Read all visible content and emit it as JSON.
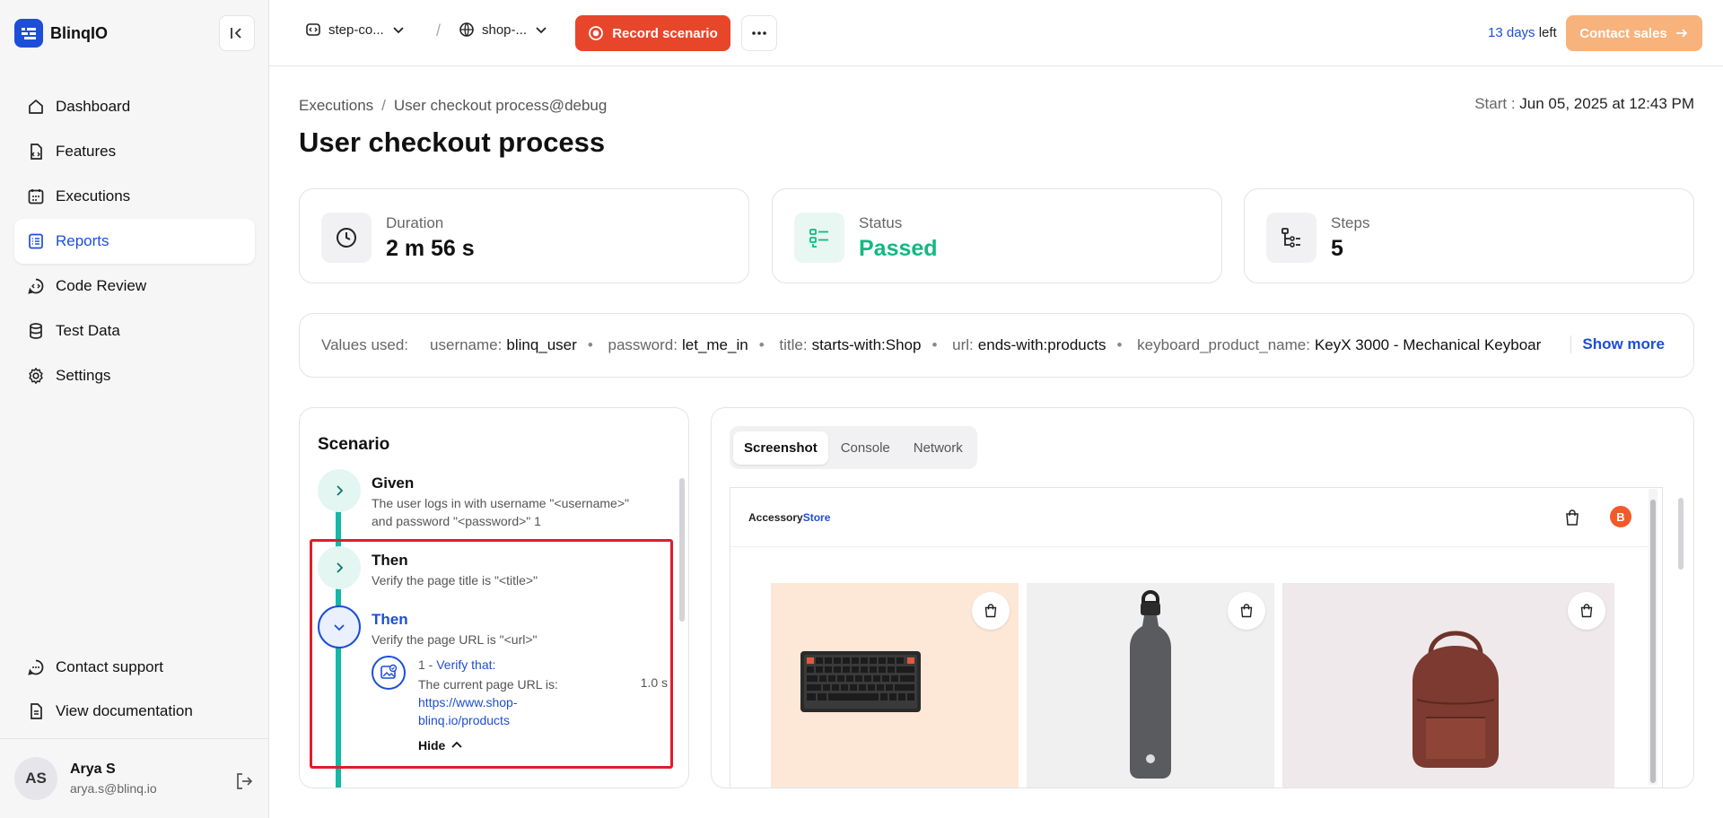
{
  "app": {
    "name": "BlinqIO"
  },
  "sidebar": {
    "items": [
      {
        "label": "Dashboard",
        "icon": "home-icon"
      },
      {
        "label": "Features",
        "icon": "file-code-icon"
      },
      {
        "label": "Executions",
        "icon": "calendar-grid-icon"
      },
      {
        "label": "Reports",
        "icon": "list-document-icon",
        "active": true
      },
      {
        "label": "Code Review",
        "icon": "code-chat-icon"
      },
      {
        "label": "Test Data",
        "icon": "database-icon"
      },
      {
        "label": "Settings",
        "icon": "gear-icon"
      }
    ],
    "bottom": [
      {
        "label": "Contact support",
        "icon": "chat-dots-icon"
      },
      {
        "label": "View documentation",
        "icon": "document-icon"
      }
    ],
    "user": {
      "initials": "AS",
      "name": "Arya S",
      "email": "arya.s@blinq.io"
    }
  },
  "topbar": {
    "project": "step-co...",
    "environment": "shop-...",
    "record_label": "Record scenario",
    "trial_days": "13 days",
    "trial_suffix": " left",
    "contact_label": "Contact sales"
  },
  "page": {
    "breadcrumb": [
      "Executions",
      "User checkout process@debug"
    ],
    "start_label": "Start : ",
    "start_value": "Jun 05, 2025 at 12:43 PM",
    "title": "User checkout process"
  },
  "stats": {
    "duration": {
      "label": "Duration",
      "value": "2 m 56 s"
    },
    "status": {
      "label": "Status",
      "value": "Passed",
      "color": "#10b981"
    },
    "steps": {
      "label": "Steps",
      "value": "5"
    }
  },
  "values_used": {
    "label": "Values used:",
    "pairs": [
      {
        "key": "username:",
        "value": "blinq_user"
      },
      {
        "key": "password:",
        "value": "let_me_in"
      },
      {
        "key": "title:",
        "value": "starts-with:Shop"
      },
      {
        "key": "url:",
        "value": "ends-with:products"
      },
      {
        "key": "keyboard_product_name:",
        "value": "KeyX 3000 - Mechanical Keyboar"
      }
    ],
    "show_more": "Show more"
  },
  "scenario": {
    "title": "Scenario",
    "steps": [
      {
        "keyword": "Given",
        "desc": "The user logs in with username \"<username>\" and password \"<password>\" 1"
      },
      {
        "keyword": "Then",
        "desc": "Verify the page title is \"<title>\""
      },
      {
        "keyword": "Then",
        "desc": "Verify the page URL is \"<url>\""
      }
    ],
    "substep": {
      "index": "1 - ",
      "action": "Verify that:",
      "text": "The current page URL is:",
      "time": "1.0 s",
      "link": "https://www.shop-blinq.io/products",
      "hide_label": "Hide"
    }
  },
  "panel": {
    "tabs": [
      "Screenshot",
      "Console",
      "Network"
    ],
    "active_tab": "Screenshot",
    "store": {
      "name_a": "Accessory",
      "name_b": "Store",
      "avatar": "B"
    }
  },
  "colors": {
    "accent": "#1d4ed8",
    "record": "#e8462b",
    "contact": "#f8b27b",
    "success": "#10b981",
    "highlight": "#e11d2a"
  }
}
